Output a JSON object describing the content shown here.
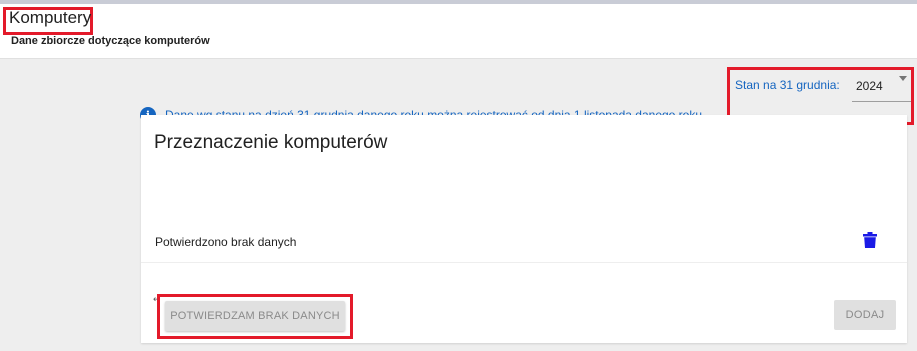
{
  "header": {
    "title": "Komputery",
    "subtitle": "Dane zbiorcze dotyczące komputerów"
  },
  "info": {
    "icon": "info-icon",
    "text": "Dane wg stanu na dzień 31 grudnia danego roku można rejestrować od dnia 1 listopada danego roku."
  },
  "year_select": {
    "label": "Stan na 31 grudnia:",
    "value": "2024"
  },
  "card": {
    "title": "Przeznaczenie komputerów",
    "row_text": "Potwierdzono brak danych",
    "confirm_button": "POTWIERDZAM BRAK DANYCH",
    "add_button": "DODAJ"
  },
  "colors": {
    "accent_blue": "#1565c0",
    "highlight_red": "#e31a2a",
    "trash_blue": "#1a1ae6"
  }
}
